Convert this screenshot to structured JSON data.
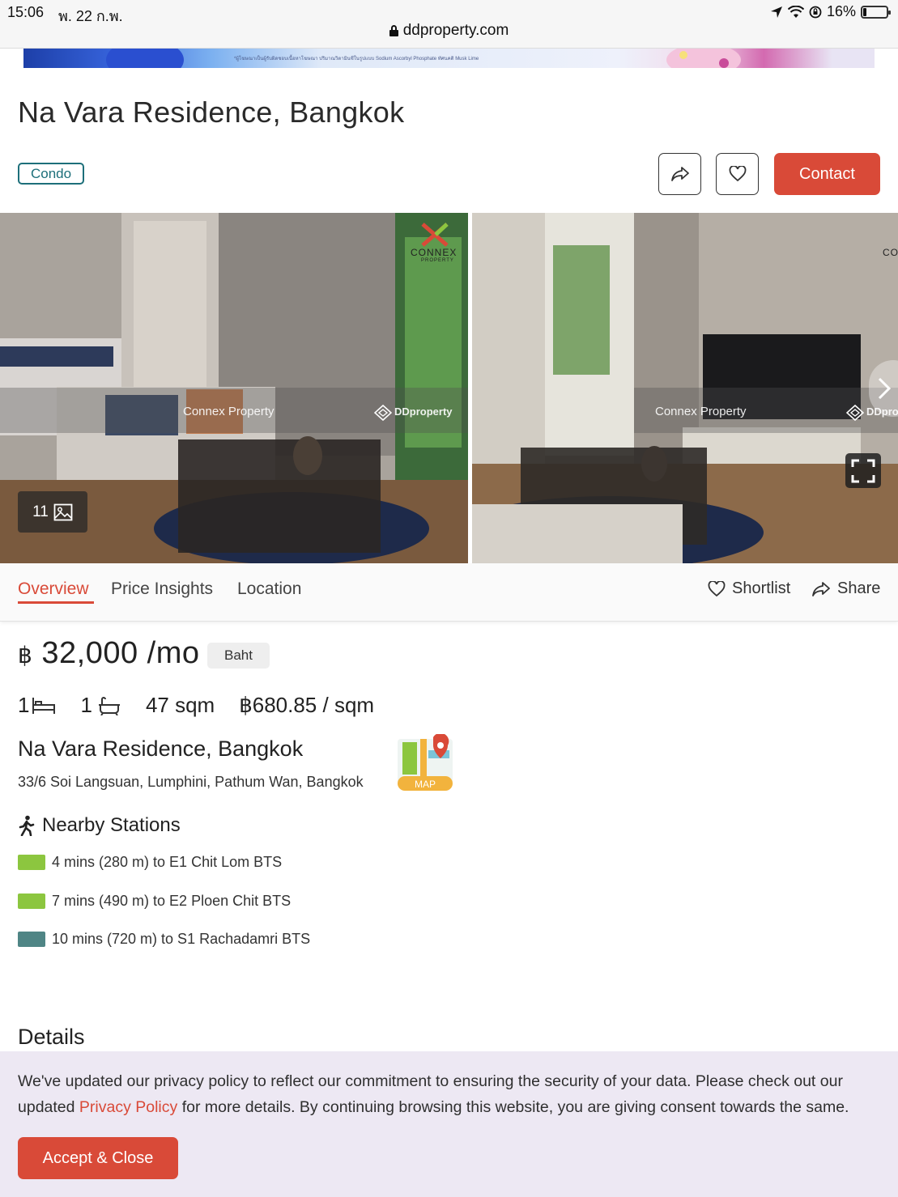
{
  "status_bar": {
    "time": "15:06",
    "date": "พ. 22 ก.พ.",
    "battery": "16%",
    "battery_level": 0.16,
    "url": "ddproperty.com"
  },
  "ad_banner": {
    "text": "*ผู้โฆษณาเป็นผู้รับผิดชอบเนื้อหาโฆษณา ปริมาณวิตามินซีในรูปแบบ Sodium Ascorbyl Phosphate ทัศนคติ Musk Lime"
  },
  "listing": {
    "title": "Na Vara Residence, Bangkok",
    "type_badge": "Condo",
    "contact_label": "Contact",
    "photo_count": "11"
  },
  "gallery": {
    "photo_1": {
      "watermark_left": "Connex Property",
      "watermark_right": "DDproperty",
      "logo": "CONNEX",
      "logo_sub": "PROPERTY"
    },
    "photo_2": {
      "watermark_left": "Connex Property",
      "watermark_right": "DDpro",
      "logo": "CO"
    }
  },
  "tabs": {
    "overview": "Overview",
    "price_insights": "Price Insights",
    "location": "Location",
    "shortlist": "Shortlist",
    "share": "Share"
  },
  "price": {
    "symbol": "฿",
    "amount": "32,000 /mo",
    "currency": "Baht"
  },
  "specs": {
    "bedrooms": "1",
    "bathrooms": "1",
    "area": "47 sqm",
    "price_per_sqm": "฿680.85 / sqm"
  },
  "project": {
    "name": "Na Vara Residence, Bangkok",
    "address": "33/6 Soi Langsuan, Lumphini, Pathum Wan, Bangkok",
    "map_label": "MAP"
  },
  "nearby": {
    "title": "Nearby Stations",
    "stations": [
      {
        "label": "4 mins (280 m) to E1 Chit Lom BTS",
        "color": "#8cc63f"
      },
      {
        "label": "7 mins (490 m) to E2 Ploen Chit BTS",
        "color": "#8cc63f"
      },
      {
        "label": "10 mins (720 m) to S1 Rachadamri BTS",
        "color": "#4f8585"
      }
    ]
  },
  "details": {
    "title": "Details"
  },
  "cookie": {
    "text_before": "We've updated our privacy policy to reflect our commitment to ensuring the security of your data. Please check out our updated ",
    "link": "Privacy Policy",
    "text_after": " for more details. By continuing browsing this website, you are giving consent towards the same.",
    "accept_label": "Accept & Close"
  },
  "colors": {
    "accent": "#d94a38",
    "badge_border": "#1d6f7a",
    "cookie_bg": "#ede8f3"
  }
}
